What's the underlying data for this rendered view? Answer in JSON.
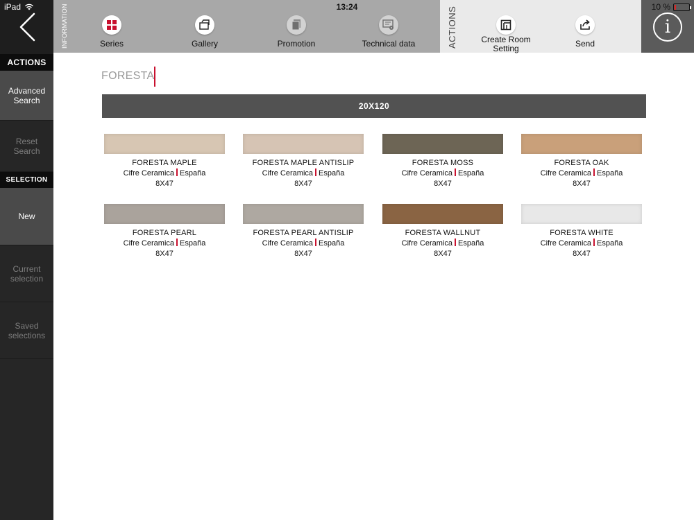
{
  "status_bar": {
    "carrier": "iPad",
    "time": "13:24",
    "battery_text": "10 %",
    "battery_level_percent": 10
  },
  "sidebar": {
    "actions_header": "ACTIONS",
    "advanced_search": "Advanced Search",
    "reset_search": "Reset Search",
    "selection_header": "SELECTION",
    "new": "New",
    "current_selection": "Current selection",
    "saved_selections": "Saved selections"
  },
  "toolbar": {
    "information_label": "INFORMATION",
    "series": "Series",
    "gallery": "Gallery",
    "promotion": "Promotion",
    "technical_data": "Technical data",
    "actions_label": "ACTIONS",
    "create_room_setting": "Create Room Setting",
    "send": "Send"
  },
  "main": {
    "title": "FORESTA",
    "size_band": "20X120",
    "tiles": [
      {
        "name": "FORESTA MAPLE",
        "maker": "Cifre Ceramica",
        "country": "España",
        "format": "8X47",
        "color": "#d7c6b3"
      },
      {
        "name": "FORESTA MAPLE ANTISLIP",
        "maker": "Cifre Ceramica",
        "country": "España",
        "format": "8X47",
        "color": "#d6c4b4"
      },
      {
        "name": "FORESTA MOSS",
        "maker": "Cifre Ceramica",
        "country": "España",
        "format": "8X47",
        "color": "#6d6555"
      },
      {
        "name": "FORESTA OAK",
        "maker": "Cifre Ceramica",
        "country": "España",
        "format": "8X47",
        "color": "#c9a07a"
      },
      {
        "name": "FORESTA PEARL",
        "maker": "Cifre Ceramica",
        "country": "España",
        "format": "8X47",
        "color": "#aaa39c"
      },
      {
        "name": "FORESTA PEARL ANTISLIP",
        "maker": "Cifre Ceramica",
        "country": "España",
        "format": "8X47",
        "color": "#aea8a1"
      },
      {
        "name": "FORESTA WALLNUT",
        "maker": "Cifre Ceramica",
        "country": "España",
        "format": "8X47",
        "color": "#8a6443"
      },
      {
        "name": "FORESTA WHITE",
        "maker": "Cifre Ceramica",
        "country": "España",
        "format": "8X47",
        "color": "#e8e8e8"
      }
    ]
  },
  "colors": {
    "accent_red": "#c8102e",
    "toolbar_grey": "#a8a8a8",
    "actions_bg": "#eaeaea",
    "sidebar_bg": "#262626",
    "size_band_bg": "#525252"
  }
}
